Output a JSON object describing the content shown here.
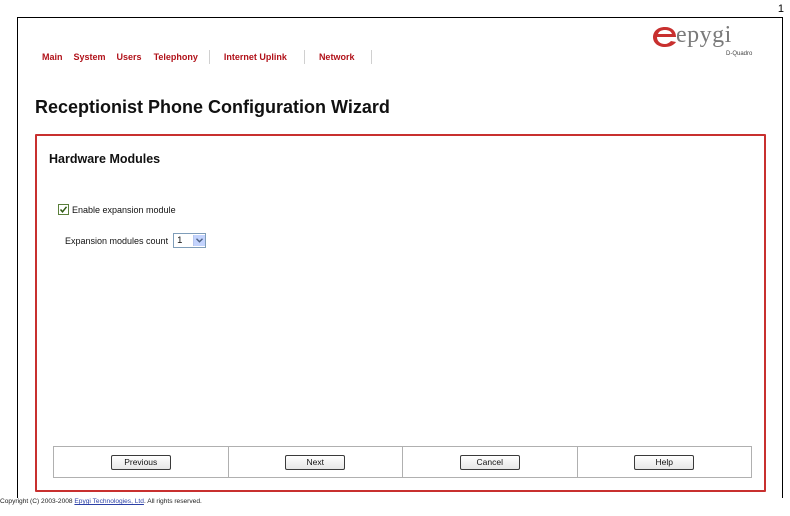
{
  "page_number": "1",
  "nav": {
    "items": [
      "Main",
      "System",
      "Users",
      "Telephony",
      "Internet Uplink",
      "Network"
    ]
  },
  "logo": {
    "word": "epygi",
    "subtitle": "D-Quadro"
  },
  "title": "Receptionist Phone Configuration Wizard",
  "panel": {
    "title": "Hardware Modules",
    "enable_label": "Enable expansion module",
    "enable_checked": true,
    "count_label": "Expansion modules count",
    "count_value": "1"
  },
  "buttons": {
    "previous": "Previous",
    "next": "Next",
    "cancel": "Cancel",
    "help": "Help"
  },
  "footer": {
    "prefix": "Copyright (C) 2003-2008 ",
    "company": "Epygi Technologies, Ltd",
    "suffix": ". All rights reserved."
  },
  "colors": {
    "accent": "#c8302f",
    "menu": "#b1121a"
  }
}
